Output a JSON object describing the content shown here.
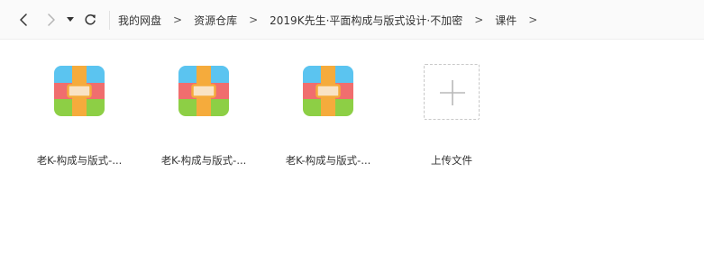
{
  "navigation": {
    "back_icon": "chevron-left-icon",
    "forward_icon": "chevron-right-icon",
    "history_icon": "dropdown-triangle-icon",
    "refresh_icon": "refresh-icon"
  },
  "breadcrumb": {
    "items": [
      "我的网盘",
      "资源仓库",
      "2019K先生·平面构成与版式设计·不加密",
      "课件"
    ],
    "separator": ">"
  },
  "files": [
    {
      "name": "老K-构成与版式-...",
      "icon": "archive-icon"
    },
    {
      "name": "老K-构成与版式-...",
      "icon": "archive-icon"
    },
    {
      "name": "老K-构成与版式-...",
      "icon": "archive-icon"
    }
  ],
  "upload": {
    "label": "上传文件",
    "icon": "plus-icon"
  },
  "colors": {
    "archive_top": "#5bc4f0",
    "archive_middle": "#f06e6e",
    "archive_bottom": "#8dcf45",
    "archive_strap": "#f5ab3c",
    "upload_border": "#c8c8c8"
  }
}
